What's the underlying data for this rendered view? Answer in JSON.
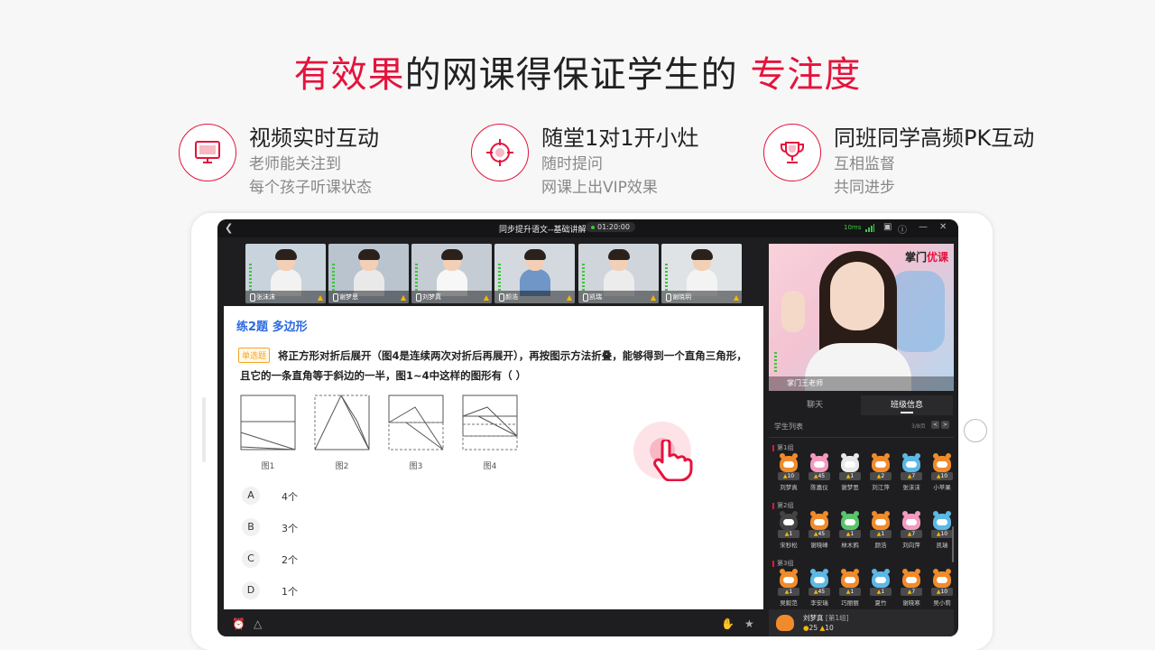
{
  "headline": {
    "part1": "有效果",
    "part2": "的网课得保证学生的 ",
    "part3": "专注度"
  },
  "features": [
    {
      "icon": "monitor-icon",
      "title": "视频实时互动",
      "line1": "老师能关注到",
      "line2": "每个孩子听课状态"
    },
    {
      "icon": "target-icon",
      "title": "随堂1对1开小灶",
      "line1": "随时提问",
      "line2": "网课上出VIP效果"
    },
    {
      "icon": "trophy-icon",
      "title": "同班同学高频PK互动",
      "line1": "互相监督",
      "line2": "共同进步"
    }
  ],
  "app": {
    "title": "同步提升语文--基础讲解",
    "timer": "01:20:00",
    "latency": "10ms",
    "accent": "#e5133c"
  },
  "students_video": [
    {
      "name": "张沫沫",
      "shirt": "#f2f2f2",
      "bg": "#c9d3dc"
    },
    {
      "name": "谢梦思",
      "shirt": "#e9e9e9",
      "bg": "#b9c4cf"
    },
    {
      "name": "刘梦真",
      "shirt": "#f7f7f7",
      "bg": "#c6ccd3"
    },
    {
      "name": "颜浩",
      "shirt": "#6f96c6",
      "bg": "#d3d9df"
    },
    {
      "name": "凯瑞",
      "shirt": "#ececec",
      "bg": "#cfd5db"
    },
    {
      "name": "谢晓玥",
      "shirt": "#f3f3f3",
      "bg": "#dfe3e6"
    }
  ],
  "question": {
    "title": "练2题  多边形",
    "tag": "单选题",
    "text": "将正方形对折后展开（图4是连续两次对折后再展开），再按图示方法折叠，能够得到一个直角三角形，且它的一条直角等于斜边的一半，图1~4中这样的图形有（   ）",
    "figures": [
      "图1",
      "图2",
      "图3",
      "图4"
    ],
    "options": [
      {
        "letter": "A",
        "value": "4个"
      },
      {
        "letter": "B",
        "value": "3个"
      },
      {
        "letter": "C",
        "value": "2个"
      },
      {
        "letter": "D",
        "value": "1个"
      }
    ]
  },
  "teacher": {
    "logo1": "掌门",
    "logo2": "优课",
    "name": "掌门王老师"
  },
  "tabs": {
    "chat": "聊天",
    "class_info": "班级信息"
  },
  "student_list": {
    "title": "学生列表",
    "page": "3/8页",
    "prev": "<",
    "next": ">",
    "groups": [
      {
        "label": "第1组",
        "students": [
          {
            "name": "刘梦真",
            "score": "10",
            "color": "#f08b2c"
          },
          {
            "name": "陈嘉仪",
            "score": "45",
            "color": "#f49ac1"
          },
          {
            "name": "谢梦思",
            "score": "1",
            "color": "#e8e8e8"
          },
          {
            "name": "刘江萍",
            "score": "2",
            "color": "#f08b2c"
          },
          {
            "name": "张沫沫",
            "score": "7",
            "color": "#5cb8e6"
          },
          {
            "name": "小苹果",
            "score": "10",
            "color": "#f08b2c"
          }
        ]
      },
      {
        "label": "第2组",
        "students": [
          {
            "name": "宋秒松",
            "score": "1",
            "color": "#444444"
          },
          {
            "name": "谢晓峰",
            "score": "45",
            "color": "#f08b2c"
          },
          {
            "name": "林木鸦",
            "score": "1",
            "color": "#5cc46c"
          },
          {
            "name": "颜浩",
            "score": "1",
            "color": "#f08b2c"
          },
          {
            "name": "刘向萍",
            "score": "7",
            "color": "#f49ac1"
          },
          {
            "name": "凯瑞",
            "score": "10",
            "color": "#5cb8e6"
          }
        ]
      },
      {
        "label": "第3组",
        "students": [
          {
            "name": "吴毅范",
            "score": "1",
            "color": "#f08b2c"
          },
          {
            "name": "李安瑞",
            "score": "45",
            "color": "#5cb8e6"
          },
          {
            "name": "巧丽丽",
            "score": "1",
            "color": "#f08b2c"
          },
          {
            "name": "夏竹",
            "score": "1",
            "color": "#5cb8e6"
          },
          {
            "name": "谢晓寒",
            "score": "7",
            "color": "#f08b2c"
          },
          {
            "name": "吴小莉",
            "score": "10",
            "color": "#f08b2c"
          }
        ]
      }
    ]
  },
  "me": {
    "name": "刘梦真",
    "group": "[第1组]",
    "coins": "25",
    "likes": "10"
  }
}
